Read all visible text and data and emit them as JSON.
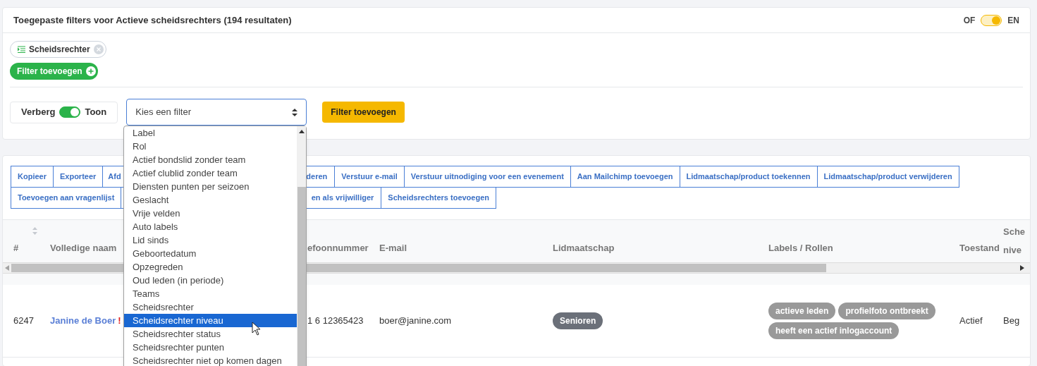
{
  "filter_panel": {
    "title": "Toegepaste filters voor Actieve scheidsrechters (194 resultaten)",
    "logic_toggle": {
      "off_label": "OF",
      "on_label": "EN",
      "on": true
    },
    "applied_filters": [
      {
        "label": "Scheidsrechter"
      }
    ],
    "add_filter_pill": "Filter toevoegen",
    "visibility_toggle": {
      "off_label": "Verberg",
      "on_label": "Toon",
      "on": true
    },
    "filter_select": {
      "value": "Kies een filter",
      "open": true,
      "options": [
        {
          "label": "Label",
          "selected": false
        },
        {
          "label": "Rol",
          "selected": false
        },
        {
          "label": "Actief bondslid zonder team",
          "selected": false
        },
        {
          "label": "Actief clublid zonder team",
          "selected": false
        },
        {
          "label": "Diensten punten per seizoen",
          "selected": false
        },
        {
          "label": "Geslacht",
          "selected": false
        },
        {
          "label": "Vrije velden",
          "selected": false
        },
        {
          "label": "Auto labels",
          "selected": false
        },
        {
          "label": "Lid sinds",
          "selected": false
        },
        {
          "label": "Geboortedatum",
          "selected": false
        },
        {
          "label": "Opzegreden",
          "selected": false
        },
        {
          "label": "Oud leden (in periode)",
          "selected": false
        },
        {
          "label": "Teams",
          "selected": false
        },
        {
          "label": "Scheidsrechter",
          "selected": false
        },
        {
          "label": "Scheidsrechter niveau",
          "selected": true
        },
        {
          "label": "Scheidsrechter status",
          "selected": false
        },
        {
          "label": "Scheidsrechter punten",
          "selected": false
        },
        {
          "label": "Scheidsrechter niet op komen dagen",
          "selected": false
        }
      ]
    },
    "add_filter_button": "Filter toevoegen"
  },
  "actions": {
    "buttons": [
      {
        "label": "Kopieer",
        "kind": "plain"
      },
      {
        "label": "Exporteer",
        "kind": "plain"
      },
      {
        "label": "Afd",
        "kind": "cut_left"
      },
      {
        "label": "deren",
        "kind": "cut_right"
      },
      {
        "label": "Verstuur e-mail",
        "kind": "plain"
      },
      {
        "label": "Verstuur uitnodiging voor een evenement",
        "kind": "plain"
      },
      {
        "label": "Aan Mailchimp toevoegen",
        "kind": "plain"
      },
      {
        "label": "Lidmaatschap/product toekennen",
        "kind": "plain"
      },
      {
        "label": "Lidmaatschap/product verwijderen",
        "kind": "plain"
      },
      {
        "label": "Toevoegen aan vragenlijst",
        "kind": "plain"
      },
      {
        "label": "en als vrijwilliger",
        "kind": "cut_wide"
      },
      {
        "label": "Scheidsrechters toevoegen",
        "kind": "plain"
      }
    ]
  },
  "table": {
    "columns": [
      "#",
      "Volledige naam",
      "efoonnummer",
      "E-mail",
      "Lidmaatschap",
      "Labels / Rollen",
      "Toestand",
      "Sche nive"
    ],
    "rows": [
      {
        "id": "6247",
        "name": "Janine de Boer",
        "warning": "!",
        "phone": "1 6 12365423",
        "email": "boer@janine.com",
        "membership": "Senioren",
        "labels": [
          "actieve leden",
          "profielfoto ontbreekt",
          "heeft een actief inlogaccount"
        ],
        "status": "Actief",
        "level": "Beg"
      }
    ]
  }
}
